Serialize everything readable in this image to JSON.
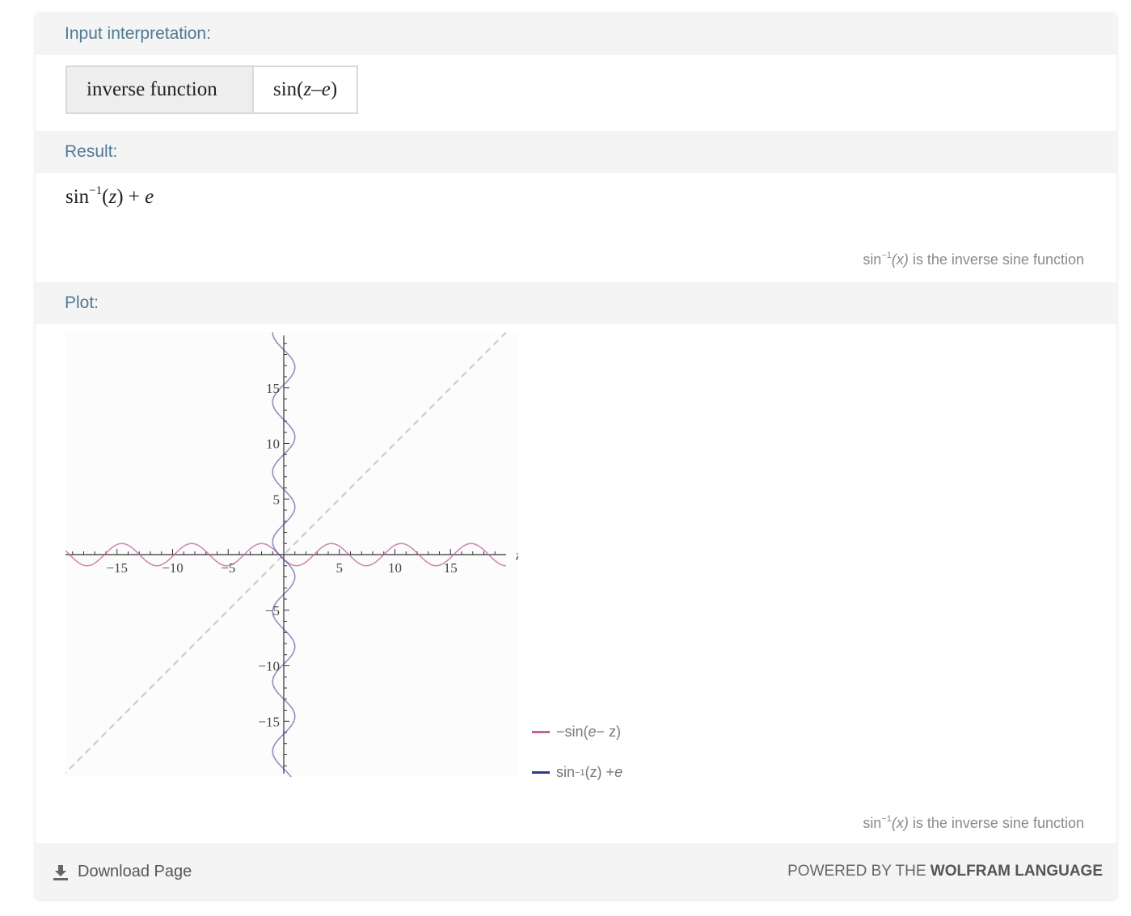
{
  "pods": {
    "input": {
      "title": "Input interpretation:",
      "cell_left": "inverse function",
      "cell_right_fn": "sin(",
      "cell_right_z": "z",
      "cell_right_op": " – ",
      "cell_right_e": "e",
      "cell_right_close": ")"
    },
    "result": {
      "title": "Result:",
      "expr_sin": "sin",
      "expr_sup": "−1",
      "expr_open": "(",
      "expr_z": "z",
      "expr_rest": ") + ",
      "expr_e": "e",
      "footnote_sin": "sin",
      "footnote_sup": "−1",
      "footnote_x": "(x)",
      "footnote_text": " is the inverse sine function"
    },
    "plot": {
      "title": "Plot:",
      "footnote_sin": "sin",
      "footnote_sup": "−1",
      "footnote_x": "(x)",
      "footnote_text": " is the inverse sine function"
    }
  },
  "chart_data": {
    "type": "line",
    "title": "",
    "xlabel": "z",
    "ylabel": "",
    "xlim": [
      -20,
      20
    ],
    "ylim": [
      -20,
      20
    ],
    "x_ticks": [
      -15,
      -10,
      -5,
      5,
      10,
      15
    ],
    "y_ticks": [
      15,
      10,
      5,
      -5,
      -10,
      -15
    ],
    "grid": false,
    "legend_placement": "bottom-right",
    "series": [
      {
        "name": "−sin(e − z)",
        "color": "#c0649e",
        "x": [
          -20,
          -15,
          -10,
          -5,
          0,
          5,
          10,
          15,
          20
        ],
        "y": [
          0.97,
          -0.07,
          -0.99,
          0.92,
          -0.41,
          0.63,
          -0.06,
          -0.66,
          0.99
        ]
      },
      {
        "name": "sin⁻¹(z) + e",
        "color": "#2c3a8c",
        "x": [
          0.41,
          -0.07,
          -0.97,
          0.88,
          -0.41,
          0.62,
          -0.07,
          -0.66,
          0.99
        ],
        "y": [
          -20,
          -15,
          -10,
          -5,
          0,
          5,
          10,
          15,
          20
        ]
      },
      {
        "name": "y = z",
        "color": "#c8c8c8",
        "x": [
          -20,
          20
        ],
        "y": [
          -20,
          20
        ]
      }
    ],
    "legend": [
      {
        "text_a": "−sin(",
        "text_e": "e",
        "text_b": " − z)",
        "color": "#c0649e"
      },
      {
        "text_a": "sin",
        "sup": "−1",
        "text_b": "(z) + ",
        "text_e": "e",
        "color": "#2c3a8c"
      }
    ]
  },
  "footer": {
    "download_label": "Download Page",
    "powered_prefix": "POWERED BY THE ",
    "powered_brand": "WOLFRAM LANGUAGE"
  },
  "colors": {
    "title": "#4e7a94",
    "band": "#f4f4f4",
    "pink": "#c0649e",
    "blue": "#2c3a8c"
  },
  "icons": {
    "download": "download-icon"
  }
}
